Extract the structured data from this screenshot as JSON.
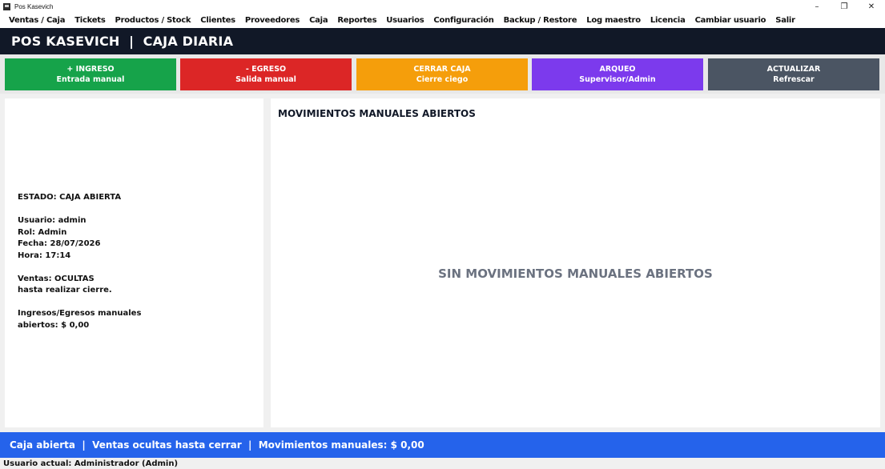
{
  "window": {
    "title": "Pos Kasevich",
    "controls": {
      "minimize": "–",
      "restore": "❐",
      "close": "✕"
    }
  },
  "menu": {
    "items": [
      "Ventas / Caja",
      "Tickets",
      "Productos / Stock",
      "Clientes",
      "Proveedores",
      "Caja",
      "Reportes",
      "Usuarios",
      "Configuración",
      "Backup / Restore",
      "Log maestro",
      "Licencia",
      "Cambiar usuario",
      "Salir"
    ]
  },
  "header": {
    "title": "POS KASEVICH  |  CAJA DIARIA"
  },
  "actions": {
    "ingreso": {
      "label": "+ INGRESO",
      "sub": "Entrada manual"
    },
    "egreso": {
      "label": "- EGRESO",
      "sub": "Salida manual"
    },
    "cerrar": {
      "label": "CERRAR CAJA",
      "sub": "Cierre ciego"
    },
    "arqueo": {
      "label": "ARQUEO",
      "sub": "Supervisor/Admin"
    },
    "actualizar": {
      "label": "ACTUALIZAR",
      "sub": "Refrescar"
    }
  },
  "status": {
    "estado": "ESTADO: CAJA ABIERTA",
    "usuario": "Usuario: admin",
    "rol": "Rol: Admin",
    "fecha": "Fecha: 28/07/2026",
    "hora": "Hora: 17:14",
    "ventas": "Ventas: OCULTAS",
    "ventas_note": "hasta realizar cierre.",
    "manuales_label": "Ingresos/Egresos manuales",
    "manuales_value": "abiertos: $ 0,00"
  },
  "movimientos": {
    "title": "MOVIMIENTOS MANUALES ABIERTOS",
    "empty": "SIN MOVIMIENTOS MANUALES ABIERTOS"
  },
  "footer": {
    "status": "Caja abierta  |  Ventas ocultas hasta cerrar  |  Movimientos manuales: $ 0,00",
    "user": "Usuario actual: Administrador (Admin)"
  },
  "colors": {
    "header_bg": "#111827",
    "ingreso": "#16a34a",
    "egreso": "#dc2626",
    "cerrar": "#f59e0b",
    "arqueo": "#7c3aed",
    "actualizar": "#4b5563",
    "footer_bg": "#2563eb"
  }
}
